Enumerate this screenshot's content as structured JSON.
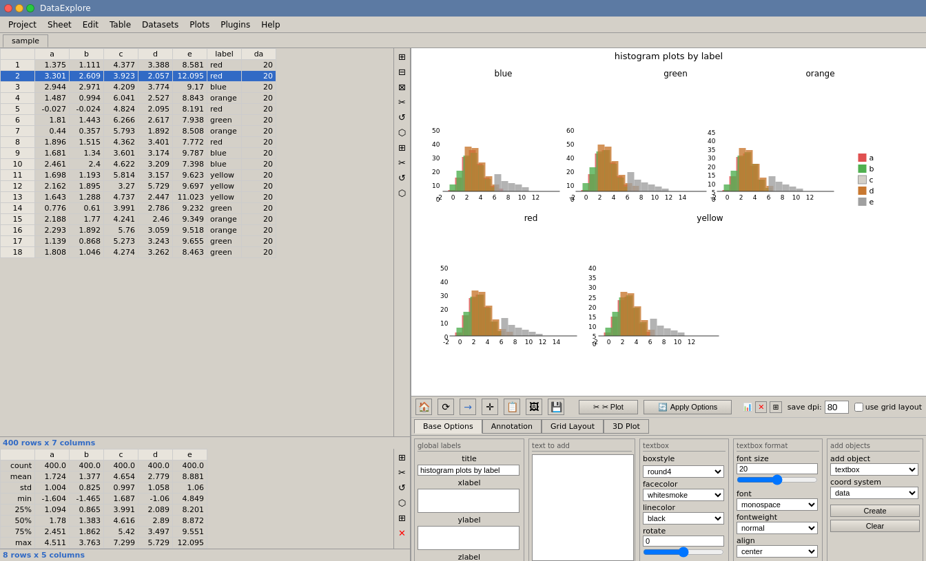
{
  "app": {
    "title": "DataExplore",
    "icon": "📊"
  },
  "menu": {
    "items": [
      "Project",
      "Sheet",
      "Edit",
      "Table",
      "Datasets",
      "Plots",
      "Plugins",
      "Help"
    ]
  },
  "tab": {
    "name": "sample"
  },
  "table": {
    "columns": [
      "",
      "a",
      "b",
      "c",
      "d",
      "e",
      "label",
      "da"
    ],
    "rows": [
      [
        "1",
        "1.375",
        "1.111",
        "4.377",
        "3.388",
        "8.581",
        "red",
        "20"
      ],
      [
        "2",
        "3.301",
        "2.609",
        "3.923",
        "2.057",
        "12.095",
        "red",
        "20"
      ],
      [
        "3",
        "2.944",
        "2.971",
        "4.209",
        "3.774",
        "9.17",
        "blue",
        "20"
      ],
      [
        "4",
        "1.487",
        "0.994",
        "6.041",
        "2.527",
        "8.843",
        "orange",
        "20"
      ],
      [
        "5",
        "-0.027",
        "-0.024",
        "4.824",
        "2.095",
        "8.191",
        "red",
        "20"
      ],
      [
        "6",
        "1.81",
        "1.443",
        "6.266",
        "2.617",
        "7.938",
        "green",
        "20"
      ],
      [
        "7",
        "0.44",
        "0.357",
        "5.793",
        "1.892",
        "8.508",
        "orange",
        "20"
      ],
      [
        "8",
        "1.896",
        "1.515",
        "4.362",
        "3.401",
        "7.772",
        "red",
        "20"
      ],
      [
        "9",
        "1.681",
        "1.34",
        "3.601",
        "3.174",
        "9.787",
        "blue",
        "20"
      ],
      [
        "10",
        "2.461",
        "2.4",
        "4.622",
        "3.209",
        "7.398",
        "blue",
        "20"
      ],
      [
        "11",
        "1.698",
        "1.193",
        "5.814",
        "3.157",
        "9.623",
        "yellow",
        "20"
      ],
      [
        "12",
        "2.162",
        "1.895",
        "3.27",
        "5.729",
        "9.697",
        "yellow",
        "20"
      ],
      [
        "13",
        "1.643",
        "1.288",
        "4.737",
        "2.447",
        "11.023",
        "yellow",
        "20"
      ],
      [
        "14",
        "0.776",
        "0.61",
        "3.991",
        "2.786",
        "9.232",
        "green",
        "20"
      ],
      [
        "15",
        "2.188",
        "1.77",
        "4.241",
        "2.46",
        "9.349",
        "orange",
        "20"
      ],
      [
        "16",
        "2.293",
        "1.892",
        "5.76",
        "3.059",
        "9.518",
        "orange",
        "20"
      ],
      [
        "17",
        "1.139",
        "0.868",
        "5.273",
        "3.243",
        "9.655",
        "green",
        "20"
      ],
      [
        "18",
        "1.808",
        "1.046",
        "4.274",
        "3.262",
        "8.463",
        "green",
        "20"
      ]
    ],
    "row_info": "400 rows x 7 columns"
  },
  "stats_table": {
    "columns": [
      "",
      "a",
      "b",
      "c",
      "d",
      "e"
    ],
    "rows": [
      [
        "count",
        "400.0",
        "400.0",
        "400.0",
        "400.0",
        "400.0"
      ],
      [
        "mean",
        "1.724",
        "1.377",
        "4.654",
        "2.779",
        "8.881"
      ],
      [
        "std",
        "1.004",
        "0.825",
        "0.997",
        "1.058",
        "1.06"
      ],
      [
        "min",
        "-1.604",
        "-1.465",
        "1.687",
        "-1.06",
        "4.849"
      ],
      [
        "25%",
        "1.094",
        "0.865",
        "3.991",
        "2.089",
        "8.201"
      ],
      [
        "50%",
        "1.78",
        "1.383",
        "4.616",
        "2.89",
        "8.872"
      ],
      [
        "75%",
        "2.451",
        "1.862",
        "5.42",
        "3.497",
        "9.551"
      ],
      [
        "max",
        "4.511",
        "3.763",
        "7.299",
        "5.729",
        "12.095"
      ]
    ],
    "row_info": "8 rows x 5 columns"
  },
  "chart": {
    "title": "histogram plots by label",
    "subplots": [
      {
        "title": "blue",
        "x_range": [
          -2,
          12
        ],
        "y_range": [
          0,
          50
        ]
      },
      {
        "title": "green",
        "x_range": [
          -2,
          14
        ],
        "y_range": [
          0,
          60
        ]
      },
      {
        "title": "orange",
        "x_range": [
          -2,
          12
        ],
        "y_range": [
          0,
          45
        ]
      },
      {
        "title": "red",
        "x_range": [
          -2,
          14
        ],
        "y_range": [
          0,
          50
        ]
      },
      {
        "title": "yellow",
        "x_range": [
          -2,
          12
        ],
        "y_range": [
          0,
          40
        ]
      }
    ],
    "legend": [
      {
        "label": "a",
        "color": "#e05050"
      },
      {
        "label": "b",
        "color": "#50b050"
      },
      {
        "label": "c",
        "color": "#d4d0c8"
      },
      {
        "label": "d",
        "color": "#c87830"
      },
      {
        "label": "e",
        "color": "#a0a0a0"
      }
    ]
  },
  "control": {
    "toolbar_icons": [
      "🏠",
      "⟳",
      "→",
      "✛",
      "📋",
      "🖼",
      "💾"
    ],
    "plot_button": "✂ Plot",
    "apply_button": "🔄 Apply Options",
    "save_dpi_label": "save dpi:",
    "save_dpi_value": "80",
    "use_grid_layout": "use grid layout",
    "tabs": [
      "Base Options",
      "Annotation",
      "Grid Layout",
      "3D Plot"
    ],
    "global_labels": {
      "title_label": "title",
      "title_value": "histogram plots by label",
      "xlabel_label": "xlabel",
      "xlabel_value": "",
      "ylabel_label": "ylabel",
      "ylabel_value": "",
      "zlabel_label": "zlabel",
      "zlabel_value": ""
    },
    "text_to_add": {
      "label": "text to add",
      "value": ""
    },
    "textbox": {
      "label": "textbox",
      "boxstyle_label": "boxstyle",
      "boxstyle_value": "round4",
      "facecolor_label": "facecolor",
      "facecolor_value": "whitesmoke",
      "linecolor_label": "linecolor",
      "linecolor_value": "black",
      "rotate_label": "rotate",
      "rotate_value": "0"
    },
    "textbox_format": {
      "label": "textbox format",
      "fontsize_label": "font size",
      "fontsize_value": "20",
      "font_label": "font",
      "font_value": "monospace",
      "fontweight_label": "fontweight",
      "fontweight_value": "normal",
      "align_label": "align",
      "align_value": "center"
    },
    "add_objects": {
      "label": "add objects",
      "add_object_label": "add object",
      "add_object_value": "textbox",
      "coord_system_label": "coord system",
      "coord_system_value": "data",
      "create_button": "Create",
      "clear_button": "Clear"
    }
  },
  "sidebar_icons": {
    "top": [
      "📋",
      "📋",
      "📋",
      "✂",
      "🔄",
      "🌿",
      "📋",
      "✂",
      "🔄",
      "🌿"
    ],
    "bottom": [
      "❌"
    ]
  }
}
